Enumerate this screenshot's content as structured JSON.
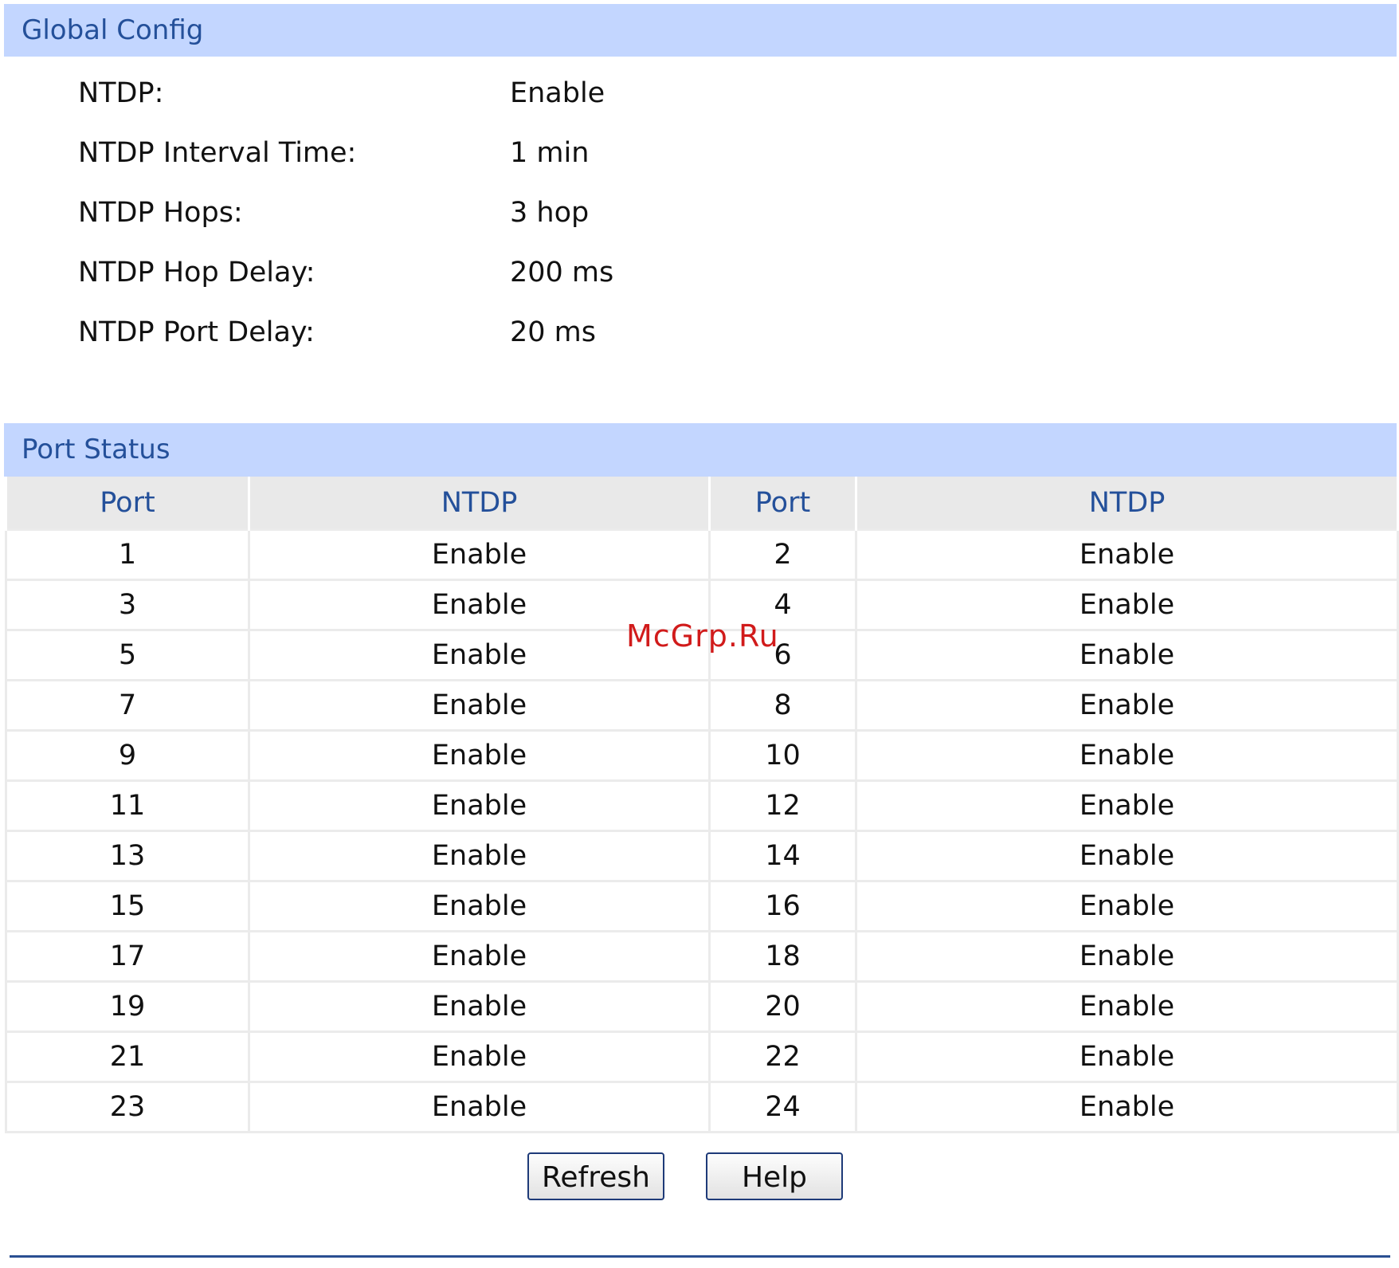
{
  "global_config": {
    "title": "Global Config",
    "rows": [
      {
        "label": "NTDP:",
        "value": "Enable"
      },
      {
        "label": "NTDP Interval Time:",
        "value": "1 min"
      },
      {
        "label": "NTDP Hops:",
        "value": "3 hop"
      },
      {
        "label": "NTDP Hop Delay:",
        "value": "200 ms"
      },
      {
        "label": "NTDP Port Delay:",
        "value": "20 ms"
      }
    ]
  },
  "port_status": {
    "title": "Port Status",
    "columns": [
      "Port",
      "NTDP",
      "Port",
      "NTDP"
    ],
    "rows": [
      [
        "1",
        "Enable",
        "2",
        "Enable"
      ],
      [
        "3",
        "Enable",
        "4",
        "Enable"
      ],
      [
        "5",
        "Enable",
        "6",
        "Enable"
      ],
      [
        "7",
        "Enable",
        "8",
        "Enable"
      ],
      [
        "9",
        "Enable",
        "10",
        "Enable"
      ],
      [
        "11",
        "Enable",
        "12",
        "Enable"
      ],
      [
        "13",
        "Enable",
        "14",
        "Enable"
      ],
      [
        "15",
        "Enable",
        "16",
        "Enable"
      ],
      [
        "17",
        "Enable",
        "18",
        "Enable"
      ],
      [
        "19",
        "Enable",
        "20",
        "Enable"
      ],
      [
        "21",
        "Enable",
        "22",
        "Enable"
      ],
      [
        "23",
        "Enable",
        "24",
        "Enable"
      ]
    ]
  },
  "buttons": {
    "refresh_label": "Refresh",
    "help_label": "Help"
  },
  "watermark": "McGrp.Ru",
  "colors": {
    "header_bg": "#c3d6ff",
    "header_text": "#24509a",
    "table_header_bg": "#e9e9e9",
    "rule": "#2a4f92"
  }
}
